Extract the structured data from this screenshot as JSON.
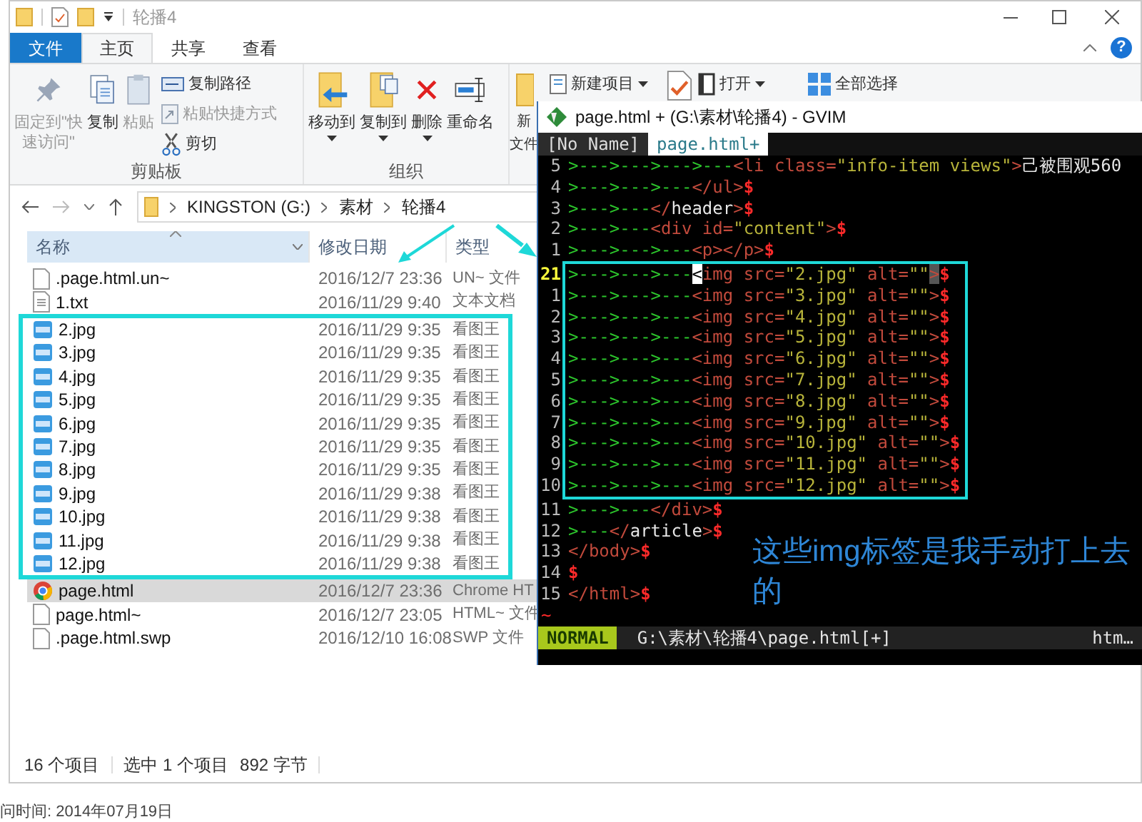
{
  "explorer": {
    "title": "轮播4",
    "ribbon_tabs": [
      {
        "label": "文件",
        "kind": "file",
        "selected": false
      },
      {
        "label": "主页",
        "kind": "tab",
        "selected": true
      },
      {
        "label": "共享",
        "kind": "tab",
        "selected": false
      },
      {
        "label": "查看",
        "kind": "tab",
        "selected": false
      }
    ],
    "help": "?",
    "ribbon_groups": [
      {
        "label": "剪贴板",
        "large": [
          {
            "label": "固定到\"快速访问\"",
            "disabled": true
          },
          {
            "label": "复制",
            "disabled": false
          },
          {
            "label": "粘贴",
            "disabled": true
          }
        ],
        "small": [
          {
            "label": "复制路径",
            "disabled": false
          },
          {
            "label": "粘贴快捷方式",
            "disabled": true
          },
          {
            "label": "剪切",
            "disabled": false
          }
        ]
      },
      {
        "label": "组织",
        "large": [
          {
            "label": "移动到",
            "dropdown": true
          },
          {
            "label": "复制到",
            "dropdown": true
          },
          {
            "label": "删除",
            "dropdown": true
          },
          {
            "label": "重命名",
            "dropdown": false
          }
        ]
      },
      {
        "large": [
          {
            "lines": [
              "新",
              "文件"
            ]
          }
        ],
        "small": [
          {
            "label": "新建项目",
            "dropdown": true
          }
        ]
      },
      {
        "small": [
          {
            "label": "打开",
            "dropdown": true
          }
        ]
      },
      {
        "small": [
          {
            "label": "全部选择"
          }
        ]
      }
    ],
    "breadcrumbs": [
      "KINGSTON (G:)",
      "素材",
      "轮播4"
    ],
    "columns": [
      "名称",
      "修改日期",
      "类型"
    ],
    "files_before": [
      {
        "name": ".page.html.un~",
        "date": "2016/12/7 23:36",
        "type": "UN~ 文件",
        "kind": "blank",
        "selected": false
      },
      {
        "name": "1.txt",
        "date": "2016/11/29 9:40",
        "type": "文本文档",
        "kind": "text",
        "selected": false
      }
    ],
    "highlighted_files": [
      {
        "name": "2.jpg",
        "date": "2016/11/29 9:35",
        "type": "看图王",
        "kind": "jpg",
        "selected": false
      },
      {
        "name": "3.jpg",
        "date": "2016/11/29 9:35",
        "type": "看图王",
        "kind": "jpg",
        "selected": false
      },
      {
        "name": "4.jpg",
        "date": "2016/11/29 9:35",
        "type": "看图王",
        "kind": "jpg",
        "selected": false
      },
      {
        "name": "5.jpg",
        "date": "2016/11/29 9:35",
        "type": "看图王",
        "kind": "jpg",
        "selected": false
      },
      {
        "name": "6.jpg",
        "date": "2016/11/29 9:35",
        "type": "看图王",
        "kind": "jpg",
        "selected": false
      },
      {
        "name": "7.jpg",
        "date": "2016/11/29 9:35",
        "type": "看图王",
        "kind": "jpg",
        "selected": false
      },
      {
        "name": "8.jpg",
        "date": "2016/11/29 9:35",
        "type": "看图王",
        "kind": "jpg",
        "selected": false
      },
      {
        "name": "9.jpg",
        "date": "2016/11/29 9:38",
        "type": "看图王",
        "kind": "jpg",
        "selected": false
      },
      {
        "name": "10.jpg",
        "date": "2016/11/29 9:38",
        "type": "看图王",
        "kind": "jpg",
        "selected": false
      },
      {
        "name": "11.jpg",
        "date": "2016/11/29 9:38",
        "type": "看图王",
        "kind": "jpg",
        "selected": false
      },
      {
        "name": "12.jpg",
        "date": "2016/11/29 9:38",
        "type": "看图王",
        "kind": "jpg",
        "selected": false
      }
    ],
    "files_after": [
      {
        "name": "page.html",
        "date": "2016/12/7 23:36",
        "type": "Chrome HT",
        "kind": "chrome",
        "selected": true
      },
      {
        "name": "page.html~",
        "date": "2016/12/7 23:05",
        "type": "HTML~ 文件",
        "kind": "blank",
        "selected": false
      },
      {
        "name": ".page.html.swp",
        "date": "2016/12/10 16:08",
        "type": "SWP 文件",
        "kind": "blank",
        "selected": false
      }
    ],
    "status": [
      "16 个项目",
      "选中 1 个项目",
      "892 字节"
    ]
  },
  "gvim": {
    "title": "page.html + (G:\\素材\\轮播4) - GVIM",
    "tabs": [
      {
        "label": "[No Name]",
        "selected": false
      },
      {
        "label": "page.html+",
        "selected": true
      }
    ],
    "lines_before": [
      {
        "number": "5",
        "current": false,
        "tokens": [
          {
            "kind": "indent",
            "text": ">--->--->--->---"
          },
          {
            "kind": "tag",
            "text": "<li class="
          },
          {
            "kind": "string",
            "text": "\"info-item views\""
          },
          {
            "kind": "tag",
            "text": ">"
          },
          {
            "kind": "text",
            "text": "己被围观560"
          }
        ]
      },
      {
        "number": "4",
        "current": false,
        "tokens": [
          {
            "kind": "indent",
            "text": ">--->--->---"
          },
          {
            "kind": "tag",
            "text": "</ul>"
          },
          {
            "kind": "eol",
            "text": "$"
          }
        ]
      },
      {
        "number": "3",
        "current": false,
        "tokens": [
          {
            "kind": "indent",
            "text": ">--->---"
          },
          {
            "kind": "tag",
            "text": "</"
          },
          {
            "kind": "text",
            "text": "header"
          },
          {
            "kind": "tag",
            "text": ">"
          },
          {
            "kind": "eol",
            "text": "$"
          }
        ]
      },
      {
        "number": "2",
        "current": false,
        "tokens": [
          {
            "kind": "indent",
            "text": ">--->---"
          },
          {
            "kind": "tag",
            "text": "<div id="
          },
          {
            "kind": "string",
            "text": "\"content\""
          },
          {
            "kind": "tag",
            "text": ">"
          },
          {
            "kind": "eol",
            "text": "$"
          }
        ]
      },
      {
        "number": "1",
        "current": false,
        "tokens": [
          {
            "kind": "indent",
            "text": ">--->--->---"
          },
          {
            "kind": "tag",
            "text": "<p></p>"
          },
          {
            "kind": "eol",
            "text": "$"
          }
        ]
      }
    ],
    "highlighted_lines": [
      {
        "number": "21",
        "current": true,
        "tokens": [
          {
            "kind": "indent",
            "text": ">--->--->---"
          },
          {
            "kind": "cursor",
            "text": "<"
          },
          {
            "kind": "tag",
            "text": "img src="
          },
          {
            "kind": "string",
            "text": "\"2.jpg\""
          },
          {
            "kind": "tag",
            "text": " alt="
          },
          {
            "kind": "string",
            "text": "\"\""
          },
          {
            "kind": "match",
            "text": ">"
          },
          {
            "kind": "eol",
            "text": "$"
          }
        ]
      },
      {
        "number": "1",
        "current": false,
        "tokens": [
          {
            "kind": "indent",
            "text": ">--->--->---"
          },
          {
            "kind": "tag",
            "text": "<img src="
          },
          {
            "kind": "string",
            "text": "\"3.jpg\""
          },
          {
            "kind": "tag",
            "text": " alt="
          },
          {
            "kind": "string",
            "text": "\"\""
          },
          {
            "kind": "tag",
            "text": ">"
          },
          {
            "kind": "eol",
            "text": "$"
          }
        ]
      },
      {
        "number": "2",
        "current": false,
        "tokens": [
          {
            "kind": "indent",
            "text": ">--->--->---"
          },
          {
            "kind": "tag",
            "text": "<img src="
          },
          {
            "kind": "string",
            "text": "\"4.jpg\""
          },
          {
            "kind": "tag",
            "text": " alt="
          },
          {
            "kind": "string",
            "text": "\"\""
          },
          {
            "kind": "tag",
            "text": ">"
          },
          {
            "kind": "eol",
            "text": "$"
          }
        ]
      },
      {
        "number": "3",
        "current": false,
        "tokens": [
          {
            "kind": "indent",
            "text": ">--->--->---"
          },
          {
            "kind": "tag",
            "text": "<img src="
          },
          {
            "kind": "string",
            "text": "\"5.jpg\""
          },
          {
            "kind": "tag",
            "text": " alt="
          },
          {
            "kind": "string",
            "text": "\"\""
          },
          {
            "kind": "tag",
            "text": ">"
          },
          {
            "kind": "eol",
            "text": "$"
          }
        ]
      },
      {
        "number": "4",
        "current": false,
        "tokens": [
          {
            "kind": "indent",
            "text": ">--->--->---"
          },
          {
            "kind": "tag",
            "text": "<img src="
          },
          {
            "kind": "string",
            "text": "\"6.jpg\""
          },
          {
            "kind": "tag",
            "text": " alt="
          },
          {
            "kind": "string",
            "text": "\"\""
          },
          {
            "kind": "tag",
            "text": ">"
          },
          {
            "kind": "eol",
            "text": "$"
          }
        ]
      },
      {
        "number": "5",
        "current": false,
        "tokens": [
          {
            "kind": "indent",
            "text": ">--->--->---"
          },
          {
            "kind": "tag",
            "text": "<img src="
          },
          {
            "kind": "string",
            "text": "\"7.jpg\""
          },
          {
            "kind": "tag",
            "text": " alt="
          },
          {
            "kind": "string",
            "text": "\"\""
          },
          {
            "kind": "tag",
            "text": ">"
          },
          {
            "kind": "eol",
            "text": "$"
          }
        ]
      },
      {
        "number": "6",
        "current": false,
        "tokens": [
          {
            "kind": "indent",
            "text": ">--->--->---"
          },
          {
            "kind": "tag",
            "text": "<img src="
          },
          {
            "kind": "string",
            "text": "\"8.jpg\""
          },
          {
            "kind": "tag",
            "text": " alt="
          },
          {
            "kind": "string",
            "text": "\"\""
          },
          {
            "kind": "tag",
            "text": ">"
          },
          {
            "kind": "eol",
            "text": "$"
          }
        ]
      },
      {
        "number": "7",
        "current": false,
        "tokens": [
          {
            "kind": "indent",
            "text": ">--->--->---"
          },
          {
            "kind": "tag",
            "text": "<img src="
          },
          {
            "kind": "string",
            "text": "\"9.jpg\""
          },
          {
            "kind": "tag",
            "text": " alt="
          },
          {
            "kind": "string",
            "text": "\"\""
          },
          {
            "kind": "tag",
            "text": ">"
          },
          {
            "kind": "eol",
            "text": "$"
          }
        ]
      },
      {
        "number": "8",
        "current": false,
        "tokens": [
          {
            "kind": "indent",
            "text": ">--->--->---"
          },
          {
            "kind": "tag",
            "text": "<img src="
          },
          {
            "kind": "string",
            "text": "\"10.jpg\""
          },
          {
            "kind": "tag",
            "text": " alt="
          },
          {
            "kind": "string",
            "text": "\"\""
          },
          {
            "kind": "tag",
            "text": ">"
          },
          {
            "kind": "eol",
            "text": "$"
          }
        ]
      },
      {
        "number": "9",
        "current": false,
        "tokens": [
          {
            "kind": "indent",
            "text": ">--->--->---"
          },
          {
            "kind": "tag",
            "text": "<img src="
          },
          {
            "kind": "string",
            "text": "\"11.jpg\""
          },
          {
            "kind": "tag",
            "text": " alt="
          },
          {
            "kind": "string",
            "text": "\"\""
          },
          {
            "kind": "tag",
            "text": ">"
          },
          {
            "kind": "eol",
            "text": "$"
          }
        ]
      },
      {
        "number": "10",
        "current": false,
        "tokens": [
          {
            "kind": "indent",
            "text": ">--->--->---"
          },
          {
            "kind": "tag",
            "text": "<img src="
          },
          {
            "kind": "string",
            "text": "\"12.jpg\""
          },
          {
            "kind": "tag",
            "text": " alt="
          },
          {
            "kind": "string",
            "text": "\"\""
          },
          {
            "kind": "tag",
            "text": ">"
          },
          {
            "kind": "eol",
            "text": "$"
          }
        ]
      }
    ],
    "lines_after": [
      {
        "number": "11",
        "current": false,
        "tokens": [
          {
            "kind": "indent",
            "text": ">--->---"
          },
          {
            "kind": "tag",
            "text": "</div>"
          },
          {
            "kind": "eol",
            "text": "$"
          }
        ]
      },
      {
        "number": "12",
        "current": false,
        "tokens": [
          {
            "kind": "indent",
            "text": ">---"
          },
          {
            "kind": "tag",
            "text": "</"
          },
          {
            "kind": "text",
            "text": "article"
          },
          {
            "kind": "tag",
            "text": ">"
          },
          {
            "kind": "eol",
            "text": "$"
          }
        ]
      },
      {
        "number": "13",
        "current": false,
        "tokens": [
          {
            "kind": "tag",
            "text": "</body>"
          },
          {
            "kind": "eol",
            "text": "$"
          }
        ]
      },
      {
        "number": "14",
        "current": false,
        "tokens": [
          {
            "kind": "eol",
            "text": "$"
          }
        ]
      },
      {
        "number": "15",
        "current": false,
        "tokens": [
          {
            "kind": "tag",
            "text": "</html>"
          },
          {
            "kind": "eol",
            "text": "$"
          }
        ]
      }
    ],
    "filler": "~",
    "mode": "NORMAL",
    "path": "G:\\素材\\轮播4\\page.html[+]",
    "filetype": "htm…",
    "note": "这些img标签是我手动打上去的"
  },
  "background_page": {
    "text": "问时间: 2014年07月19日"
  }
}
